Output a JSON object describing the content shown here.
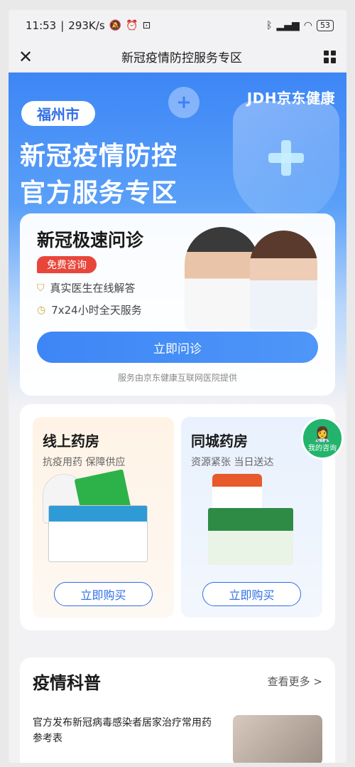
{
  "status_bar": {
    "time": "11:53",
    "speed": "293K/s",
    "battery": "53"
  },
  "nav": {
    "title": "新冠疫情防控服务专区"
  },
  "hero": {
    "brand": "JDH京东健康",
    "city": "福州市",
    "title_line1": "新冠疫情防控",
    "title_line2": "官方服务专区"
  },
  "consult": {
    "title": "新冠极速问诊",
    "badge": "免费咨询",
    "features": [
      "真实医生在线解答",
      "7x24小时全天服务"
    ],
    "button": "立即问诊",
    "note": "服务由京东健康互联网医院提供"
  },
  "pharmacy": {
    "online": {
      "title": "线上药房",
      "subtitle": "抗疫用药 保障供应",
      "button": "立即购买"
    },
    "city": {
      "title": "同城药房",
      "subtitle": "资源紧张 当日送达",
      "button": "立即购买"
    }
  },
  "float_button": {
    "label": "我的咨询"
  },
  "news": {
    "title": "疫情科普",
    "more": "查看更多 >",
    "item_text": "官方发布新冠病毒感染者居家治疗常用药参考表"
  }
}
